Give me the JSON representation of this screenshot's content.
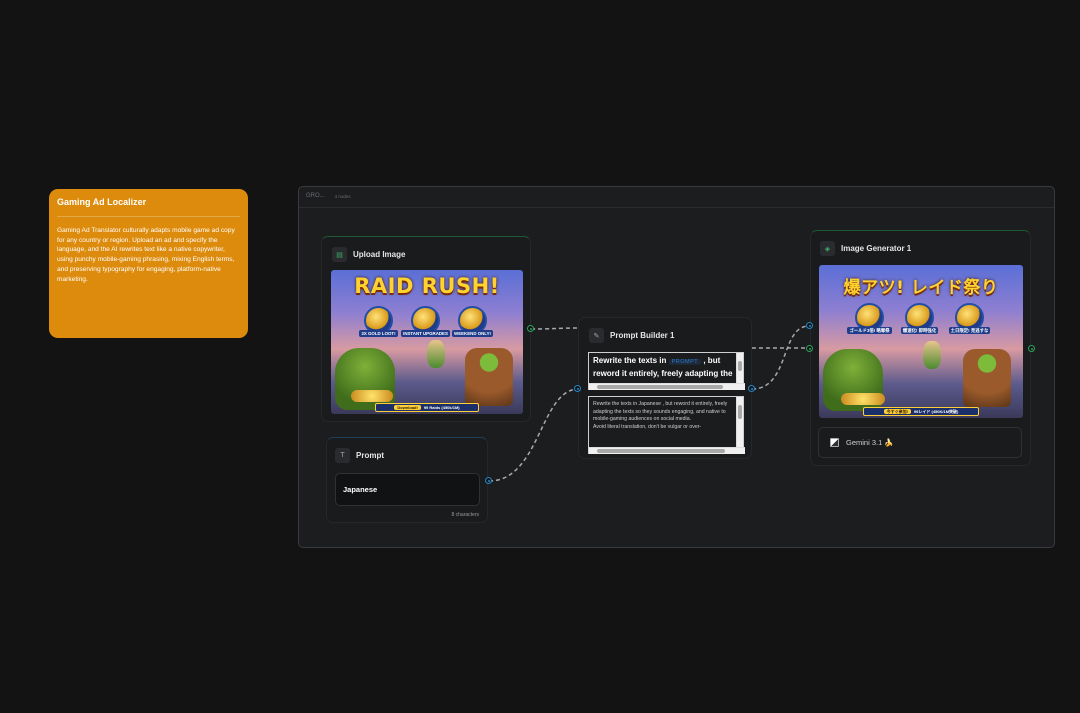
{
  "note": {
    "title": "Gaming Ad Localizer",
    "body": "Gaming Ad Translator culturally adapts mobile game ad copy for any country or region. Upload an ad and specify the language, and the AI rewrites text like a native copywriter, using punchy mobile-gaming phrasing, mixing English terms, and preserving typography for engaging, platform-native marketing."
  },
  "group": {
    "label": "GRO...",
    "count": "4 nodes"
  },
  "upload_node": {
    "title": "Upload Image",
    "ad": {
      "title": "RAID RUSH!",
      "badges": [
        "3X GOLD LOOT!",
        "INSTANT UPGRADES",
        "WEEKEND ONLY!"
      ],
      "bar_pill": "Download!",
      "bar_text": "99 Raids (450k/1M)"
    }
  },
  "prompt_node": {
    "title": "Prompt",
    "value": "Japanese",
    "char_count": "8 characters"
  },
  "builder_node": {
    "title": "Prompt Builder 1",
    "editor_text_1": "Rewrite the texts in",
    "editor_tag": "PROMPT",
    "editor_text_2": ", but reword it entirely, freely adapting the",
    "preview": "Rewrite the texts in Japanese , but reword it entirely, freely adapting the texts so they sounds engaging, and native to mobile-gaming audiences on social media.\nAvoid literal translation, don't be vulgar or over-"
  },
  "generator_node": {
    "title": "Image Generator 1",
    "ad": {
      "title": "爆アツ! レイド祭り",
      "badges": [
        "ゴールド3倍! 略奪祭",
        "爆速化! 即時強化",
        "土日限定! 見逃すな"
      ],
      "bar_pill": "今すぐ参加!",
      "bar_text": "99レイド (450K/1M突破)"
    },
    "model": "Gemini 3.1 🍌"
  },
  "colors": {
    "note_bg": "#dd8b0c",
    "canvas_bg": "#131314",
    "port_green": "#2fa35c",
    "port_blue": "#2486c9"
  }
}
